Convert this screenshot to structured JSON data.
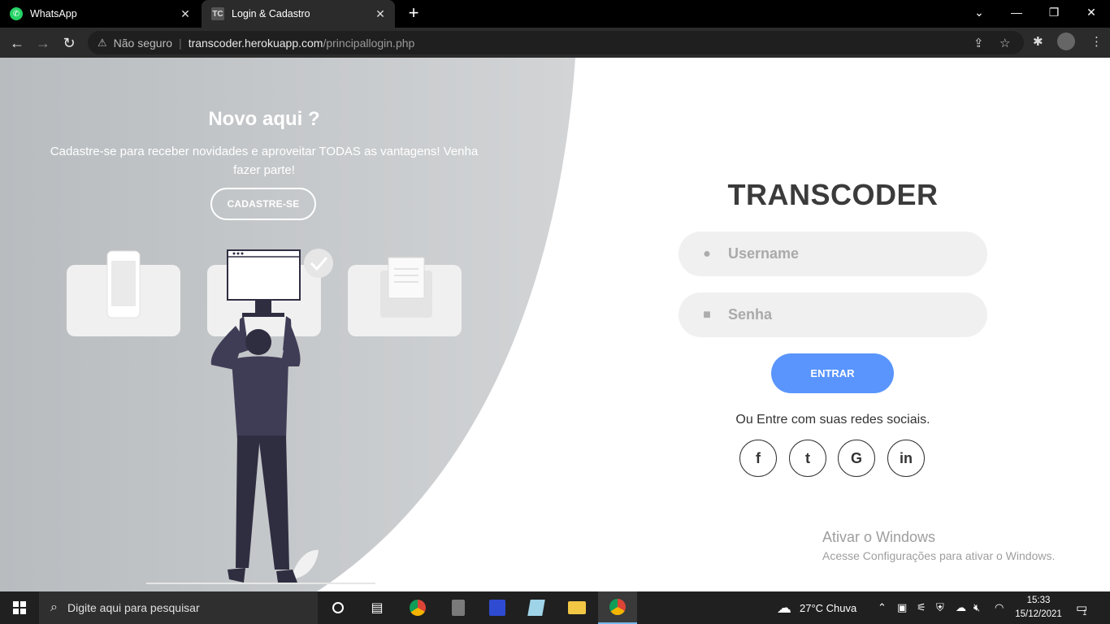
{
  "browser": {
    "tabs": [
      {
        "title": "WhatsApp",
        "active": false,
        "icon": "whatsapp-icon"
      },
      {
        "title": "Login & Cadastro",
        "active": true,
        "icon": "tc-favicon"
      }
    ],
    "security_label": "Não seguro",
    "url_host": "transcoder.herokuapp.com",
    "url_path": "/principallogin.php"
  },
  "page": {
    "left_panel": {
      "heading": "Novo aqui ?",
      "text": "Cadastre-se para receber novidades e aproveitar TODAS as vantagens! Venha fazer parte!",
      "signup_button": "CADASTRE-SE"
    },
    "form": {
      "brand": "TRANSCODER",
      "username_placeholder": "Username",
      "password_placeholder": "Senha",
      "login_button": "ENTRAR",
      "social_text": "Ou Entre com suas redes sociais.",
      "social": [
        "f",
        "t",
        "G",
        "in"
      ]
    },
    "watermark": {
      "title": "Ativar o Windows",
      "subtitle": "Acesse Configurações para ativar o Windows."
    }
  },
  "taskbar": {
    "search_placeholder": "Digite aqui para pesquisar",
    "weather": "27°C  Chuva",
    "time": "15:33",
    "date": "15/12/2021",
    "notifications": "1"
  },
  "colors": {
    "accent": "#5995fd",
    "panel_gray": "#c8cbce",
    "brand_text": "#3b3b3b"
  }
}
